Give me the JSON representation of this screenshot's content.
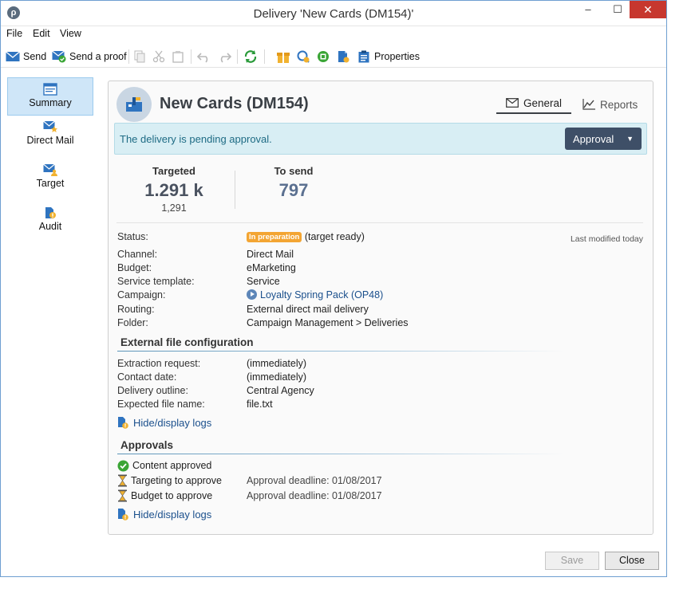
{
  "window": {
    "title": "Delivery 'New Cards (DM154)'",
    "min": "–",
    "max": "☐",
    "close": "✕"
  },
  "menu": [
    "File",
    "Edit",
    "View"
  ],
  "toolbar": {
    "send": "Send",
    "send_proof": "Send a proof",
    "properties": "Properties"
  },
  "nav": [
    {
      "label": "Summary",
      "icon": "summary-icon",
      "active": true
    },
    {
      "label": "Direct Mail",
      "icon": "direct-mail-icon"
    },
    {
      "label": "Target",
      "icon": "target-icon"
    },
    {
      "label": "Audit",
      "icon": "audit-icon"
    }
  ],
  "header": {
    "title": "New Cards (DM154)",
    "tabs": [
      "General",
      "Reports"
    ]
  },
  "pending": {
    "text": "The delivery is pending approval.",
    "button": "Approval"
  },
  "stats": {
    "targeted_label": "Targeted",
    "targeted_value": "1.291 k",
    "targeted_exact": "1,291",
    "tosend_label": "To send",
    "tosend_value": "797"
  },
  "last_modified": "Last modified today",
  "fields": {
    "status_label": "Status:",
    "status_badge": "In preparation",
    "status_text": "(target ready)",
    "channel_label": "Channel:",
    "channel": "Direct Mail",
    "budget_label": "Budget:",
    "budget": "eMarketing",
    "service_label": "Service template:",
    "service": "Service",
    "campaign_label": "Campaign:",
    "campaign": "Loyalty Spring Pack (OP48)",
    "routing_label": "Routing:",
    "routing": "External direct mail delivery",
    "folder_label": "Folder:",
    "folder": "Campaign Management > Deliveries"
  },
  "external": {
    "title": "External file configuration",
    "extraction_label": "Extraction request:",
    "extraction": "(immediately)",
    "contact_label": "Contact date:",
    "contact": "(immediately)",
    "outline_label": "Delivery outline:",
    "outline": "Central Agency",
    "filename_label": "Expected file name:",
    "filename": "file.txt",
    "logs_link": "Hide/display logs"
  },
  "approvals": {
    "title": "Approvals",
    "content": "Content approved",
    "targeting": "Targeting to approve",
    "targeting_deadline": "Approval deadline: 01/08/2017",
    "budget": "Budget to approve",
    "budget_deadline": "Approval deadline: 01/08/2017",
    "logs_link": "Hide/display logs"
  },
  "footer": {
    "save": "Save",
    "close": "Close"
  },
  "colors": {
    "accent": "#3e4f67",
    "pending_bg": "#d8eef4",
    "badge": "#f3a533",
    "approved": "#3aa535"
  }
}
